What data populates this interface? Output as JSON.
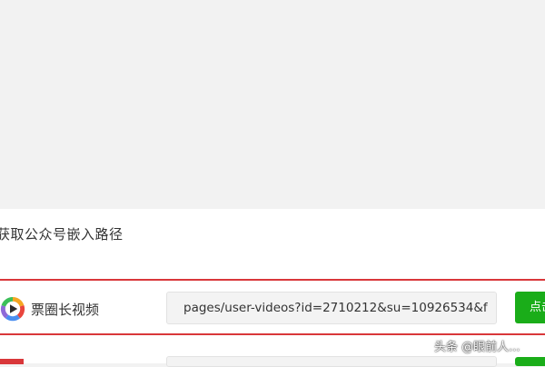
{
  "section": {
    "title": "获取公众号嵌入路径"
  },
  "row1": {
    "app_name": "票圈长视频",
    "path_value": "pages/user-videos?id=2710212&su=10926534&f",
    "button_label": "点击",
    "logo_icon": "play-logo-icon"
  },
  "watermark": "头条 @眼前人..."
}
